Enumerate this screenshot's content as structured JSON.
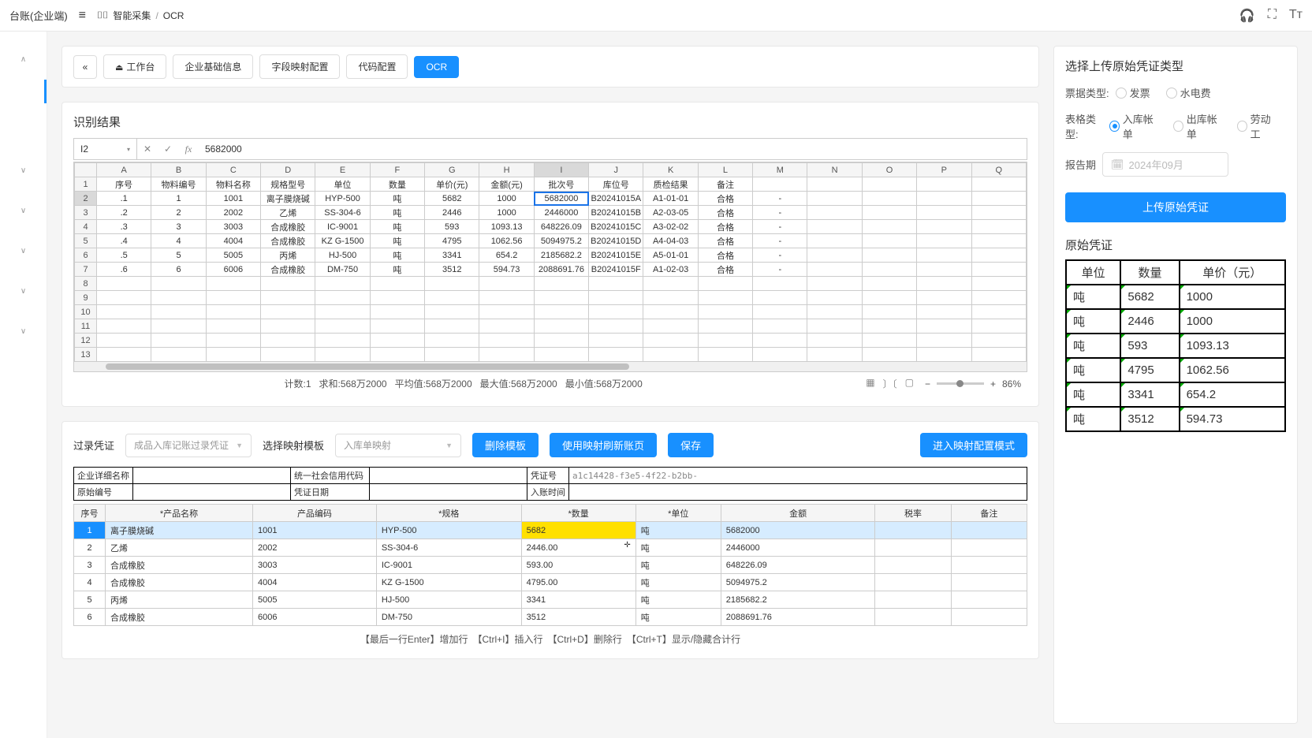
{
  "topbar": {
    "app_title": "台账(企业端)",
    "breadcrumb_root": "智能采集",
    "breadcrumb_page": "OCR"
  },
  "tabs": {
    "workbench": "工作台",
    "basic_info": "企业基础信息",
    "field_map": "字段映射配置",
    "code_cfg": "代码配置",
    "ocr": "OCR"
  },
  "ocr_panel": {
    "title": "识别结果",
    "cell_ref": "I2",
    "cell_value": "5682000",
    "col_headers": [
      "A",
      "B",
      "C",
      "D",
      "E",
      "F",
      "G",
      "H",
      "I",
      "J",
      "K",
      "L",
      "M",
      "N",
      "O",
      "P",
      "Q"
    ],
    "row_hdrs": [
      "1",
      "2",
      "3",
      "4",
      "5",
      "6",
      "7",
      "8",
      "9",
      "10",
      "11",
      "12",
      "13"
    ],
    "header_row": [
      "序号",
      "物料编号",
      "物料名称",
      "规格型号",
      "单位",
      "数量",
      "单价(元)",
      "金额(元)",
      "批次号",
      "库位号",
      "质检结果",
      "备注"
    ],
    "rows": [
      [
        ".1",
        "1",
        "1001",
        "离子膜烧碱",
        "HYP-500",
        "吨",
        "5682",
        "1000",
        "5682000",
        "B20241015A",
        "A1-01-01",
        "合格",
        "-"
      ],
      [
        ".2",
        "2",
        "2002",
        "乙烯",
        "SS-304-6",
        "吨",
        "2446",
        "1000",
        "2446000",
        "B20241015B",
        "A2-03-05",
        "合格",
        "-"
      ],
      [
        ".3",
        "3",
        "3003",
        "合成橡胶",
        "IC-9001",
        "吨",
        "593",
        "1093.13",
        "648226.09",
        "B20241015C",
        "A3-02-02",
        "合格",
        "-"
      ],
      [
        ".4",
        "4",
        "4004",
        "合成橡胶",
        "KZ G-1500",
        "吨",
        "4795",
        "1062.56",
        "5094975.2",
        "B20241015D",
        "A4-04-03",
        "合格",
        "-"
      ],
      [
        ".5",
        "5",
        "5005",
        "丙烯",
        "HJ-500",
        "吨",
        "3341",
        "654.2",
        "2185682.2",
        "B20241015E",
        "A5-01-01",
        "合格",
        "-"
      ],
      [
        ".6",
        "6",
        "6006",
        "合成橡胶",
        "DM-750",
        "吨",
        "3512",
        "594.73",
        "2088691.76",
        "B20241015F",
        "A1-02-03",
        "合格",
        "-"
      ]
    ],
    "status": {
      "count": "计数:1",
      "sum": "求和:568万2000",
      "avg": "平均值:568万2000",
      "max": "最大值:568万2000",
      "min": "最小值:568万2000",
      "zoom": "86%"
    }
  },
  "entry_panel": {
    "label_voucher": "过录凭证",
    "voucher_select": "成品入库记账过录凭证",
    "label_template": "选择映射模板",
    "template_select": "入库单映射",
    "btn_delete_tpl": "删除模板",
    "btn_refresh": "使用映射刷新账页",
    "btn_save": "保存",
    "btn_enter_cfg": "进入映射配置模式",
    "meta": {
      "enterprise_label": "企业详细名称",
      "credit_code_label": "统一社会信用代码",
      "voucher_no_label": "凭证号",
      "voucher_no_value": "a1c14428-f3e5-4f22-b2bb-",
      "orig_no_label": "原始编号",
      "voucher_date_label": "凭证日期",
      "entry_time_label": "入账时间"
    },
    "cols": [
      "序号",
      "*产品名称",
      "产品编码",
      "*规格",
      "*数量",
      "*单位",
      "金额",
      "税率",
      "备注"
    ],
    "rows": [
      {
        "idx": "1",
        "name": "离子膜烧碱",
        "code": "1001",
        "spec": "HYP-500",
        "qty": "5682",
        "unit": "吨",
        "amt": "5682000",
        "tax": "",
        "note": ""
      },
      {
        "idx": "2",
        "name": "乙烯",
        "code": "2002",
        "spec": "SS-304-6",
        "qty": "2446.00",
        "unit": "吨",
        "amt": "2446000",
        "tax": "",
        "note": ""
      },
      {
        "idx": "3",
        "name": "合成橡胶",
        "code": "3003",
        "spec": "IC-9001",
        "qty": "593.00",
        "unit": "吨",
        "amt": "648226.09",
        "tax": "",
        "note": ""
      },
      {
        "idx": "4",
        "name": "合成橡胶",
        "code": "4004",
        "spec": "KZ G-1500",
        "qty": "4795.00",
        "unit": "吨",
        "amt": "5094975.2",
        "tax": "",
        "note": ""
      },
      {
        "idx": "5",
        "name": "丙烯",
        "code": "5005",
        "spec": "HJ-500",
        "qty": "3341",
        "unit": "吨",
        "amt": "2185682.2",
        "tax": "",
        "note": ""
      },
      {
        "idx": "6",
        "name": "合成橡胶",
        "code": "6006",
        "spec": "DM-750",
        "qty": "3512",
        "unit": "吨",
        "amt": "2088691.76",
        "tax": "",
        "note": ""
      }
    ],
    "hint": "【最后一行Enter】增加行　【Ctrl+I】插入行　【Ctrl+D】删除行　【Ctrl+T】显示/隐藏合计行"
  },
  "right_panel": {
    "title": "选择上传原始凭证类型",
    "bill_type_label": "票据类型:",
    "bill_type_invoice": "发票",
    "bill_type_util": "水电费",
    "table_type_label": "表格类型:",
    "tt_inbound": "入库帐单",
    "tt_outbound": "出库帐单",
    "tt_labor": "劳动工",
    "report_period_label": "报告期",
    "report_period_ph": "2024年09月",
    "upload_btn": "上传原始凭证",
    "preview_title": "原始凭证",
    "preview_headers": [
      "单位",
      "数量",
      "单价（元）"
    ],
    "preview_rows": [
      [
        "吨",
        "5682",
        "1000"
      ],
      [
        "吨",
        "2446",
        "1000"
      ],
      [
        "吨",
        "593",
        "1093.13"
      ],
      [
        "吨",
        "4795",
        "1062.56"
      ],
      [
        "吨",
        "3341",
        "654.2"
      ],
      [
        "吨",
        "3512",
        "594.73"
      ]
    ]
  }
}
